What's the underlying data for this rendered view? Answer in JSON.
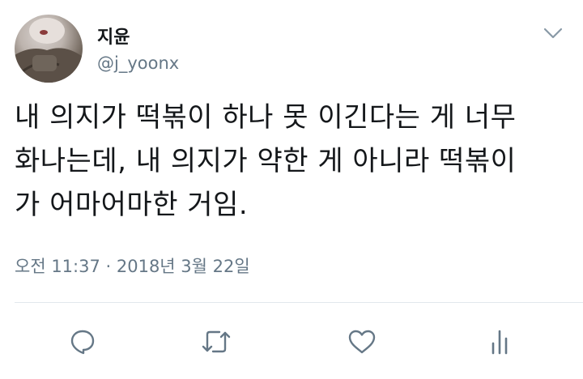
{
  "user": {
    "display_name": "지윤",
    "handle": "@j_yoonx"
  },
  "tweet": {
    "lines": [
      "내 의지가 떡볶이 하나 못 이긴다는 게 너무",
      "화나는데, 내 의지가 약한 게 아니라 떡볶이",
      "가 어마어마한 거임."
    ],
    "timestamp": "오전 11:37 · 2018년 3월 22일"
  },
  "actions": {
    "icons": [
      "reply-icon",
      "retweet-icon",
      "like-icon",
      "analytics-icon"
    ]
  },
  "colors": {
    "text": "#14171a",
    "secondary": "#657786",
    "divider": "#e1e8ed"
  }
}
